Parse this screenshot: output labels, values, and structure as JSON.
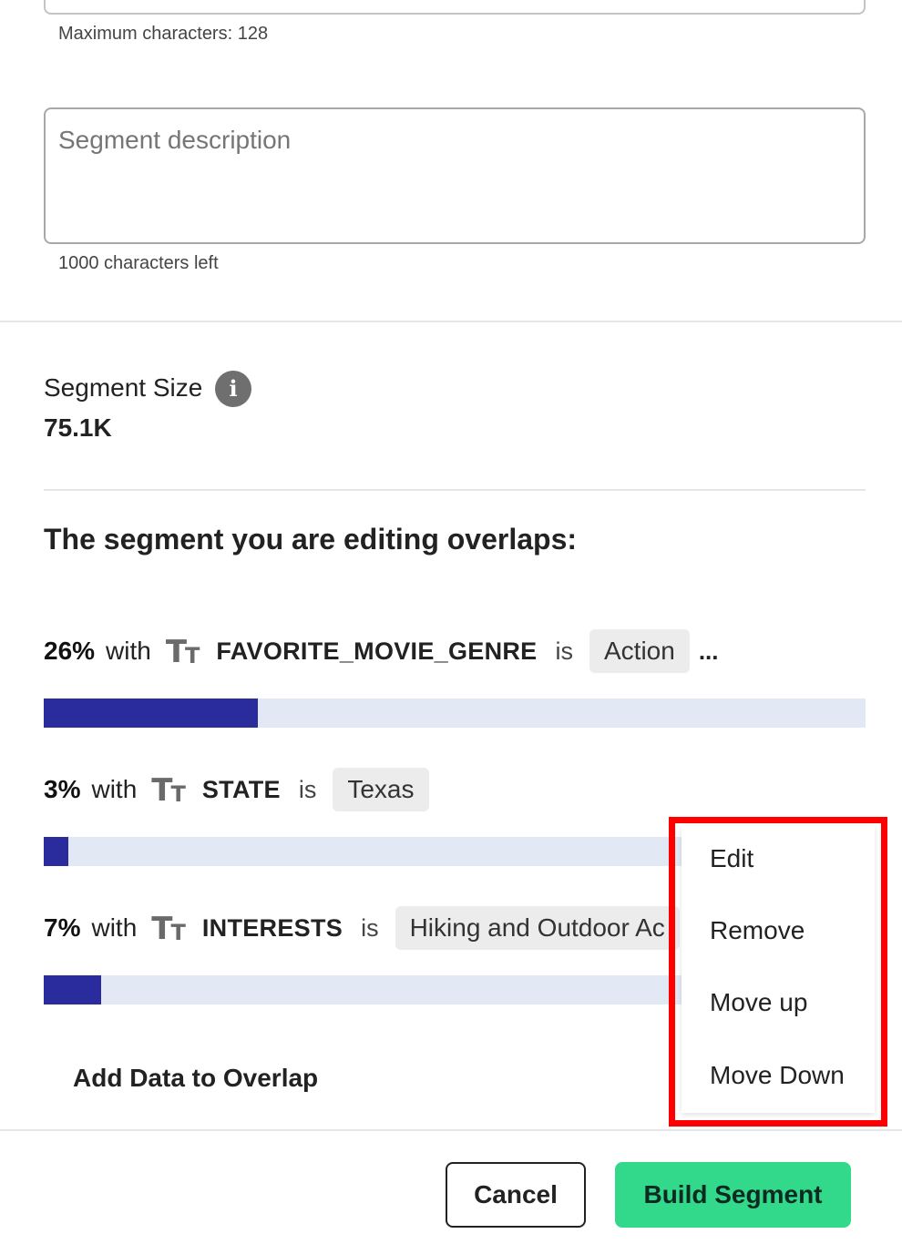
{
  "form": {
    "name_hint": "Maximum characters: 128",
    "description_placeholder": "Segment description",
    "description_hint": "1000 characters left"
  },
  "segment_size": {
    "label": "Segment Size",
    "info_icon": "info-icon",
    "value": "75.1K"
  },
  "overlap": {
    "heading": "The segment you are editing overlaps:",
    "text_type_icon": "text-type-icon",
    "rows": [
      {
        "percent": "26%",
        "with": "with",
        "field": "FAVORITE_MOVIE_GENRE",
        "operator": "is",
        "value": "Action",
        "more": "...",
        "fill": 0.26
      },
      {
        "percent": "3%",
        "with": "with",
        "field": "STATE",
        "operator": "is",
        "value": "Texas",
        "more": "",
        "fill": 0.03
      },
      {
        "percent": "7%",
        "with": "with",
        "field": "INTERESTS",
        "operator": "is",
        "value": "Hiking and Outdoor Ac",
        "more": "",
        "fill": 0.07
      }
    ],
    "add_data_label": "Add Data to Overlap"
  },
  "context_menu": {
    "items": [
      "Edit",
      "Remove",
      "Move up",
      "Move Down"
    ]
  },
  "footer": {
    "cancel_label": "Cancel",
    "build_label": "Build Segment"
  },
  "colors": {
    "bar_fill": "#2a2c9e",
    "bar_track": "#e3e8f5",
    "primary_button": "#32d98a",
    "highlight": "#ff0000"
  }
}
